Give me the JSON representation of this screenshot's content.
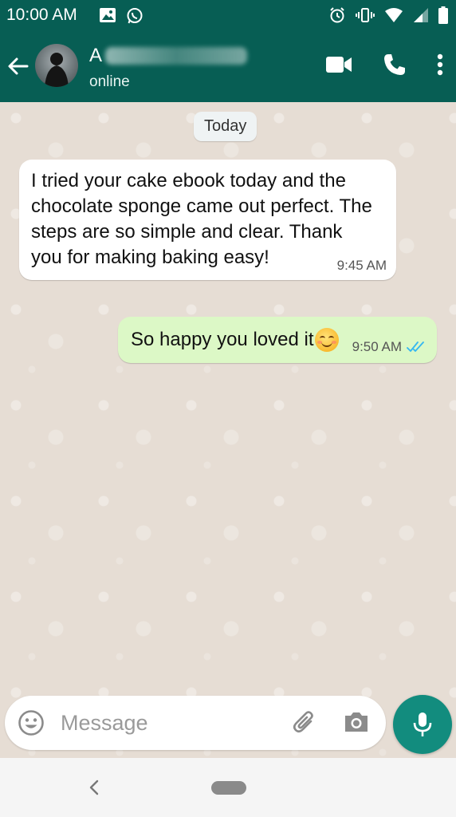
{
  "status_bar": {
    "time": "10:00 AM",
    "left_icons": [
      "gallery-icon",
      "whatsapp-icon"
    ],
    "right_icons": [
      "alarm-icon",
      "vibrate-icon",
      "wifi-icon",
      "signal-icon",
      "battery-icon"
    ]
  },
  "header": {
    "contact_initial": "A",
    "contact_status": "online",
    "actions": [
      "video-call-icon",
      "voice-call-icon",
      "more-options-icon"
    ],
    "bg_color": "#075e54"
  },
  "chat": {
    "date_label": "Today",
    "messages": [
      {
        "direction": "incoming",
        "text": "I tried your cake ebook today and the chocolate sponge came out perfect. The steps are so simple and clear. Thank you for making baking easy!",
        "time": "9:45 AM"
      },
      {
        "direction": "outgoing",
        "text": "So happy you loved it",
        "emoji": "smiling-face-emoji",
        "time": "9:50 AM",
        "status": "read",
        "status_icon": "double-check-icon"
      }
    ],
    "incoming_bubble_color": "#ffffff",
    "outgoing_bubble_color": "#dcf8c6"
  },
  "composer": {
    "placeholder": "Message",
    "icons": [
      "emoji-icon",
      "attach-icon",
      "camera-icon"
    ],
    "send_icon": "mic-icon",
    "accent_color": "#128c7e"
  },
  "nav_bar": {
    "icons": [
      "nav-back-icon",
      "nav-home-pill"
    ]
  }
}
